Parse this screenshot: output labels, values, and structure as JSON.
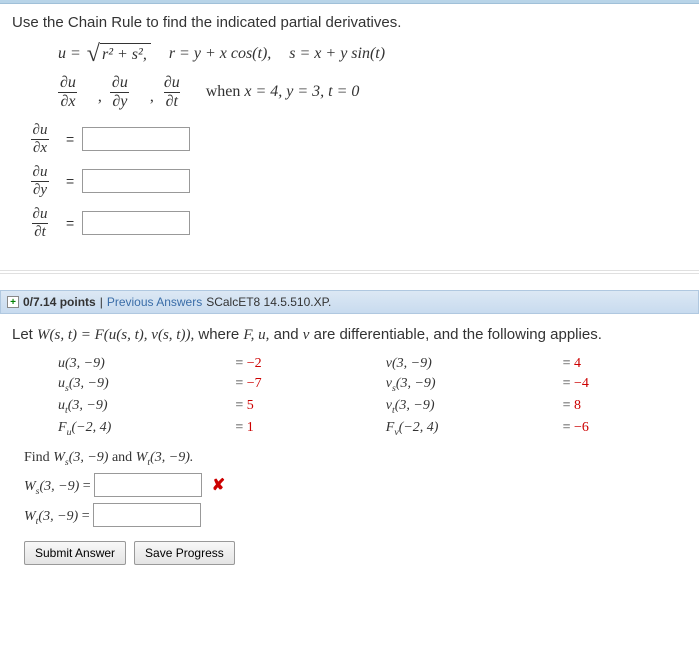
{
  "q1": {
    "instruction": "Use the Chain Rule to find the indicated partial derivatives.",
    "def_u_lhs": "u = ",
    "def_u_sqrt": "r² + s²,",
    "def_r": "r = y + x cos(t),",
    "def_s": "s = x + y sin(t)",
    "d1_top": "∂u",
    "d1_bot": "∂x",
    "d2_top": "∂u",
    "d2_bot": "∂y",
    "d3_top": "∂u",
    "d3_bot": "∂t",
    "cond_when": "when ",
    "cond_vals": "x = 4,  y = 3,  t = 0",
    "ans1_top": "∂u",
    "ans1_bot": "∂x",
    "ans2_top": "∂u",
    "ans2_bot": "∂y",
    "ans3_top": "∂u",
    "ans3_bot": "∂t"
  },
  "header2": {
    "points": "0/7.14 points",
    "sep1": "  |  ",
    "prev": "Previous Answers",
    "book": "  SCalcET8 14.5.510.XP."
  },
  "q2": {
    "intro_pre": "Let ",
    "intro_w": "W(s, t) = F(u(s, t), v(s, t)),",
    "intro_post": " where F, u, and v are differentiable, and the following applies.",
    "rows": [
      {
        "l_lhs": "u(3, −9)",
        "l_rhs": "−2",
        "r_lhs": "v(3, −9)",
        "r_rhs": "4"
      },
      {
        "l_lhs": "uₛ(3, −9)",
        "l_rhs": "−7",
        "r_lhs": "vₛ(3, −9)",
        "r_rhs": "−4"
      },
      {
        "l_lhs": "uₜ(3, −9)",
        "l_rhs": "5",
        "r_lhs": "vₜ(3, −9)",
        "r_rhs": "8"
      },
      {
        "l_lhs": "Fᵤ(−2, 4)",
        "l_rhs": "1",
        "r_lhs": "Fᵥ(−2, 4)",
        "r_rhs": "−6"
      }
    ],
    "find_pre": "Find ",
    "find_ws": "Wₛ(3, −9)",
    "find_and": " and ",
    "find_wt": "Wₜ(3, −9).",
    "ws_label": "Wₛ(3, −9)",
    "wt_label": "Wₜ(3, −9)",
    "eq": " = "
  },
  "buttons": {
    "submit": "Submit Answer",
    "save": "Save Progress"
  }
}
